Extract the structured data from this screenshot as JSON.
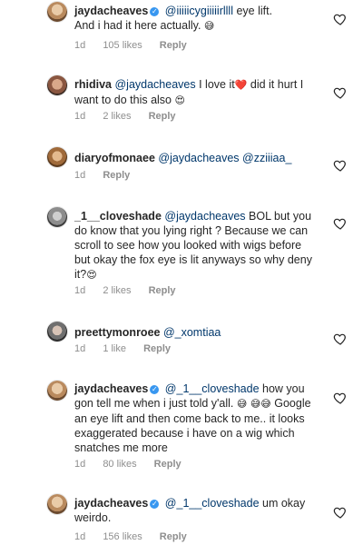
{
  "comments": [
    {
      "username": "jaydacheaves",
      "text": "@iiiiicygiiiiirllll eye lift. And i had it here actually. 😅",
      "time": "1d",
      "likes": "105 likes",
      "reply": "Reply"
    },
    {
      "username": "rhidiva",
      "text": "@jaydacheaves I love it❤️ did it hurt I want to do this also 😍",
      "time": "1d",
      "likes": "2 likes",
      "reply": "Reply"
    },
    {
      "username": "diaryofmonaee",
      "text": "@jaydacheaves @zziiiaa_",
      "time": "1d",
      "likes": "",
      "reply": "Reply"
    },
    {
      "username": "_1__cloveshade",
      "text": "@jaydacheaves BOL but you do know that you lying right ? Because we can scroll to see how you looked with wigs before but okay the fox eye is lit anyways so why deny it?😍",
      "time": "1d",
      "likes": "2 likes",
      "reply": "Reply"
    },
    {
      "username": "preettymonroee",
      "text": "@_xomtiaa",
      "time": "1d",
      "likes": "1 like",
      "reply": "Reply"
    },
    {
      "username": "jaydacheaves",
      "text": "@_1__cloveshade how you gon tell me when i just told y'all. 😅😅 Google an eye lift and then come back to me.. it looks exaggerated because i have on a wig which snatches me more",
      "time": "1d",
      "likes": "80 likes",
      "reply": "Reply"
    },
    {
      "username": "jaydacheaves",
      "text": "@_1__cloveshade um okay weirdo.",
      "time": "1d",
      "likes": "156 likes",
      "reply": "Reply"
    }
  ],
  "rich": {
    "c0_m": "@iiiiicygiiiiirllll",
    "c0_t1": " eye lift.",
    "c0_t2": "And i had it here actually. ",
    "c0_e": "😅",
    "c1_m": "@jaydacheaves",
    "c1_t1": " I love it",
    "c1_e1": "❤️",
    "c1_t2": " did it hurt I want to do this also ",
    "c1_e2": "😍",
    "c2_m1": "@jaydacheaves",
    "c2_m2": "@zziiiaa_",
    "c3_m": "@jaydacheaves",
    "c3_t": " BOL but you do know that you lying right ? Because we can scroll to see how you looked with wigs before but okay the fox eye is lit anyways so why deny it?",
    "c3_e": "😍",
    "c4_m": "@_xomtiaa",
    "c5_m": "@_1__cloveshade",
    "c5_t1": " how you gon tell me when i just told y'all. ",
    "c5_e": "😅",
    "c5_e2": "😅",
    "c5_e3": "😅",
    "c5_t2": " Google an eye lift and then come back to me.. it looks exaggerated because i have on a wig which snatches me more",
    "c6_m": "@_1__cloveshade",
    "c6_t": " um okay weirdo."
  },
  "icons": {
    "avatar": "avatar",
    "verified": "verified-badge-icon",
    "like": "heart-outline-icon"
  }
}
